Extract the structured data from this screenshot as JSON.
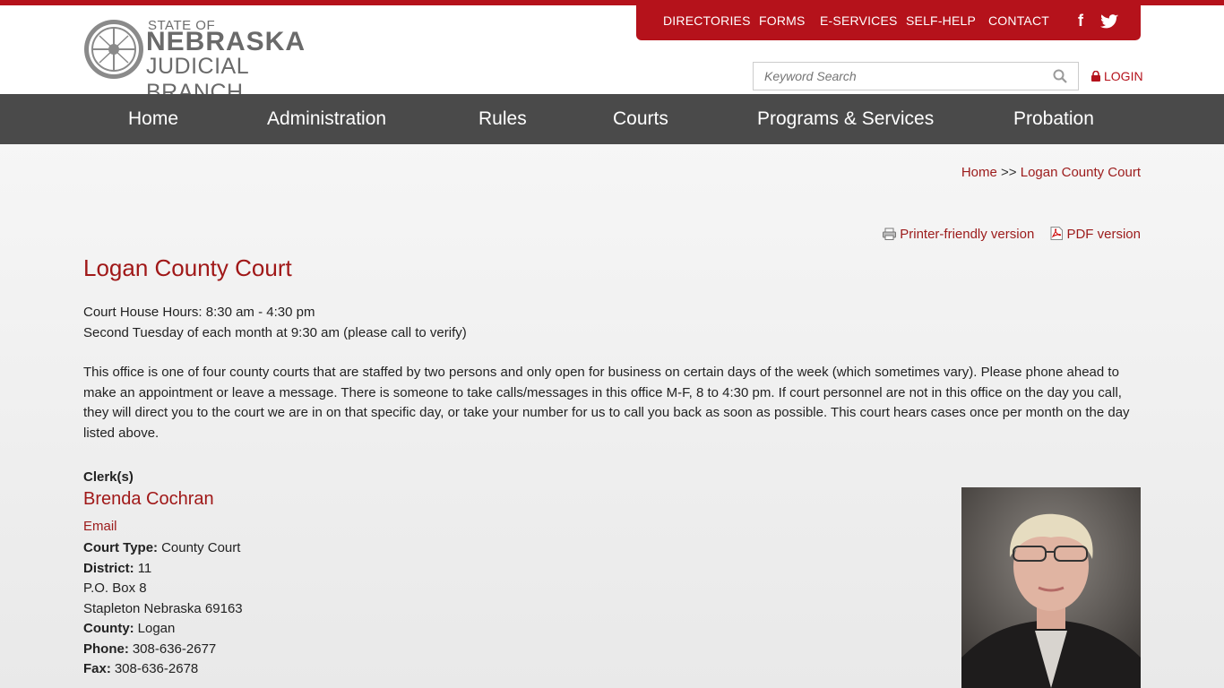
{
  "logo": {
    "line1": "STATE OF",
    "line2": "NEBRASKA",
    "line3": "JUDICIAL BRANCH"
  },
  "utility_nav": [
    "DIRECTORIES",
    "FORMS",
    "E-SERVICES",
    "SELF-HELP",
    "CONTACT"
  ],
  "social": {
    "facebook": "f",
    "twitter_icon": "twitter-icon"
  },
  "search": {
    "placeholder": "Keyword Search"
  },
  "login": "LOGIN",
  "main_nav": [
    "Home",
    "Administration",
    "Rules",
    "Courts",
    "Programs & Services",
    "Probation"
  ],
  "breadcrumb": {
    "home": "Home",
    "separator": ">>",
    "current": "Logan County Court"
  },
  "tools": {
    "printer": "Printer-friendly version",
    "pdf": "PDF version"
  },
  "page_title": "Logan County Court",
  "hours": {
    "line1": "Court House Hours: 8:30 am - 4:30 pm",
    "line2": "Second Tuesday of each month at 9:30 am (please call to verify)"
  },
  "description": "This office is one of four county courts that are staffed by two persons and only open for business on certain days of the week (which sometimes vary). Please phone ahead to make an appointment or leave a message. There is someone to take calls/messages in this office M-F, 8 to 4:30 pm. If court personnel are not in this office on the day you call, they will direct you to the court we are in on that specific day, or take your number for us to call you back as soon as possible. This court hears cases once per month on the day listed above.",
  "clerk": {
    "label": "Clerk(s)",
    "name": "Brenda Cochran",
    "email_label": "Email",
    "court_type_label": "Court Type:",
    "court_type": "County Court",
    "district_label": "District:",
    "district": "11",
    "address1": "P.O. Box 8",
    "address2": "Stapleton Nebraska 69163",
    "county_label": "County:",
    "county": "Logan",
    "phone_label": "Phone:",
    "phone": "308-636-2677",
    "fax_label": "Fax:",
    "fax": "308-636-2678"
  },
  "colors": {
    "brand_red": "#b5121b",
    "link_red": "#9c1b1b",
    "nav_gray": "#4a4a4a"
  }
}
